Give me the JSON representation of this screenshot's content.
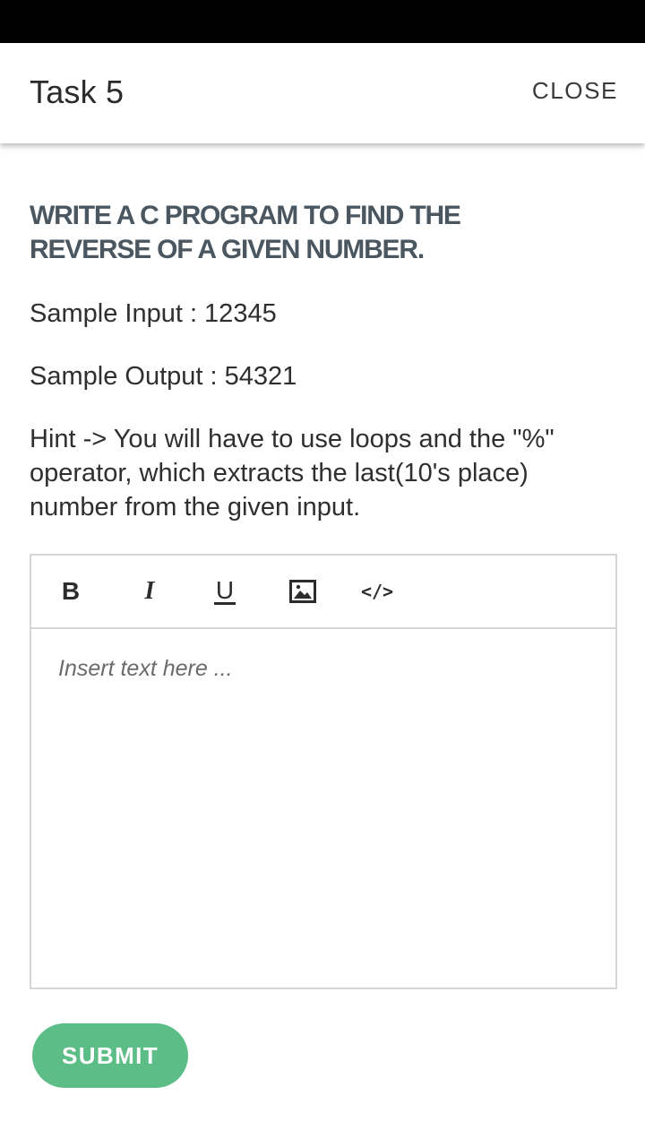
{
  "header": {
    "title": "Task 5",
    "close_label": "CLOSE"
  },
  "task": {
    "heading_line1": "WRITE A C PROGRAM TO FIND THE",
    "heading_line2": "REVERSE OF A GIVEN NUMBER.",
    "sample_input": "Sample Input : 12345",
    "sample_output": "Sample Output : 54321",
    "hint_line1": "Hint -> You will have to use loops and the \"%\"",
    "hint_line2": "operator, which extracts the last(10's place)",
    "hint_line3": "number from the given input."
  },
  "editor": {
    "toolbar": {
      "bold": "B",
      "italic": "I",
      "underline": "U",
      "code": "</>"
    },
    "placeholder": "Insert text here ..."
  },
  "submit_label": "SUBMIT",
  "colors": {
    "accent": "#5cbd87",
    "heading": "#4a5760"
  }
}
